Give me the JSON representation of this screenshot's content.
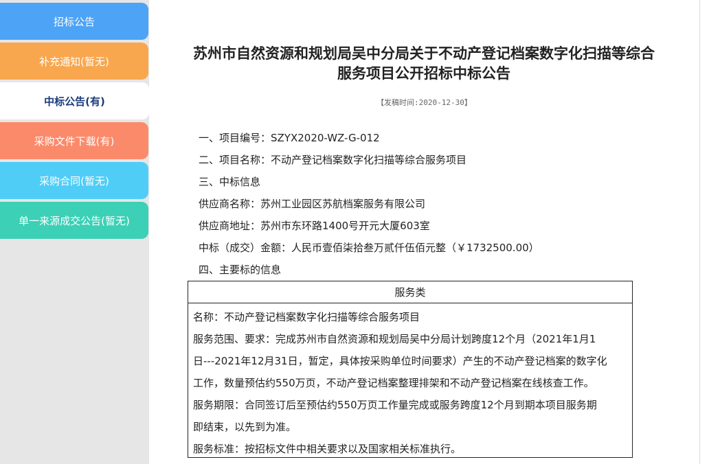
{
  "sidebar": {
    "items": [
      {
        "label": "招标公告",
        "color": "#4da3f6"
      },
      {
        "label": "补充通知(暂无)",
        "color": "#f9a74f"
      },
      {
        "label": "中标公告(有)",
        "color": "#ffffff"
      },
      {
        "label": "采购文件下载(有)",
        "color": "#fb8a6a"
      },
      {
        "label": "采购合同(暂无)",
        "color": "#4fcdf7"
      },
      {
        "label": "单一来源成交公告(暂无)",
        "color": "#3cd0b6"
      }
    ]
  },
  "article": {
    "title_line1": "苏州市自然资源和规划局吴中分局关于不动产登记档案数字化扫描等综合",
    "title_line2": "服务项目公开招标中标公告",
    "date": "【发稿时间:2020-12-30】",
    "lines": [
      "一、项目编号：SZYX2020-WZ-G-012",
      "二、项目名称：不动产登记档案数字化扫描等综合服务项目",
      "三、中标信息",
      "供应商名称：苏州工业园区苏航档案服务有限公司",
      "供应商地址：苏州市东环路1400号开元大厦603室",
      "中标（成交）金额：人民币壹佰柒拾叁万贰仟伍佰元整（￥1732500.00）",
      "四、主要标的信息"
    ],
    "table": {
      "header": "服务类",
      "rows": [
        "名称：不动产登记档案数字化扫描等综合服务项目",
        "服务范围、要求：完成苏州市自然资源和规划局吴中分局计划跨度12个月（2021年1月1",
        "日---2021年12月31日，暂定，具体按采购单位时间要求）产生的不动产登记档案的数字化",
        "工作，数量预估约550万页，不动产登记档案整理排架和不动产登记档案在线核查工作。",
        "服务期限：合同签订后至预估约550万页工作量完成或服务跨度12个月到期本项目服务期",
        "即结束，以先到为准。",
        "服务标准：按招标文件中相关要求以及国家相关标准执行。"
      ]
    }
  }
}
